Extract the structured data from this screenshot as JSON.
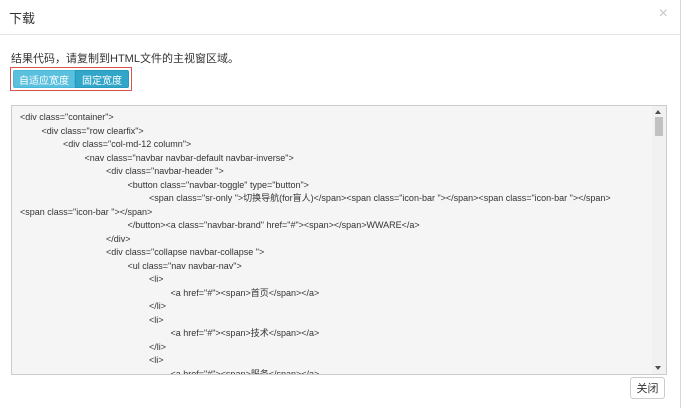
{
  "dialog": {
    "title": "下载",
    "close_symbol": "×",
    "description": "结果代码，请复制到HTML文件的主视窗区域。",
    "buttons": {
      "fluid": "自适应宽度",
      "fixed": "固定宽度"
    },
    "code_lines": [
      {
        "indent": 0,
        "text": "<div class=\"container\">"
      },
      {
        "indent": 1,
        "text": "<div class=\"row clearfix\">"
      },
      {
        "indent": 2,
        "text": "<div class=\"col-md-12 column\">"
      },
      {
        "indent": 3,
        "text": "<nav class=\"navbar navbar-default navbar-inverse\">"
      },
      {
        "indent": 4,
        "text": "<div class=\"navbar-header \">"
      },
      {
        "indent": 5,
        "text": "<button class=\"navbar-toggle\" type=\"button\">"
      },
      {
        "indent": 6,
        "text": "<span class=\"sr-only \">切换导航(for盲人)</span><span class=\"icon-bar \"></span><span class=\"icon-bar \"></span>"
      },
      {
        "indent": 0,
        "text": "<span class=\"icon-bar \"></span>"
      },
      {
        "indent": 5,
        "text": "</button><a class=\"navbar-brand\" href=\"#\"><span></span>WWARE</a>"
      },
      {
        "indent": 4,
        "text": "</div>"
      },
      {
        "indent": 4,
        "text": "<div class=\"collapse navbar-collapse \">"
      },
      {
        "indent": 5,
        "text": "<ul class=\"nav navbar-nav\">"
      },
      {
        "indent": 6,
        "text": "<li>"
      },
      {
        "indent": 7,
        "text": "<a href=\"#\"><span>首页</span></a>"
      },
      {
        "indent": 6,
        "text": "</li>"
      },
      {
        "indent": 6,
        "text": "<li>"
      },
      {
        "indent": 7,
        "text": "<a href=\"#\"><span>技术</span></a>"
      },
      {
        "indent": 6,
        "text": "</li>"
      },
      {
        "indent": 6,
        "text": "<li>"
      },
      {
        "indent": 7,
        "text": "<a href=\"#\"><span>服务</span></a>"
      }
    ],
    "close_button": "关闭"
  }
}
